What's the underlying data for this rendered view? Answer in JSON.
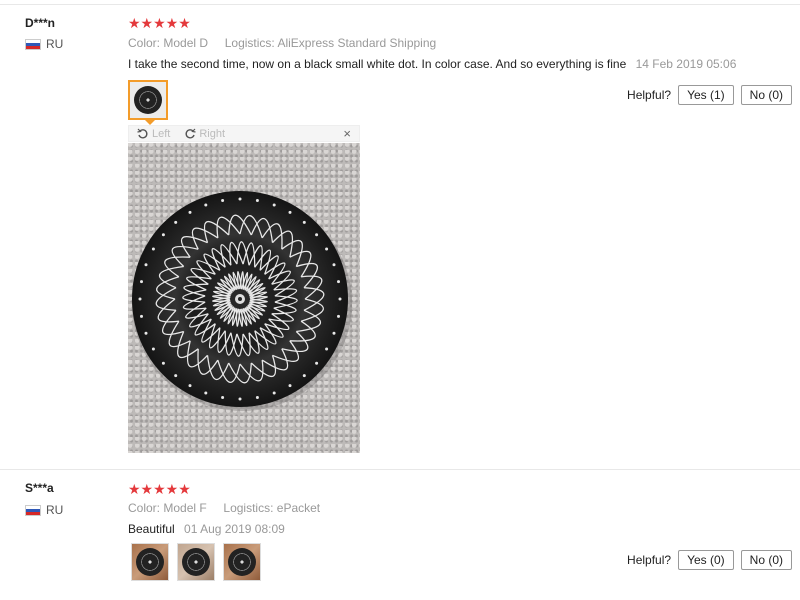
{
  "reviews": [
    {
      "user": "D***n",
      "country": "RU",
      "stars": "★★★★★",
      "color_label": "Color:",
      "color_value": "Model D",
      "logistics_label": "Logistics:",
      "logistics_value": "AliExpress Standard Shipping",
      "text": "I take the second time, now on a black small white dot. In color case. And so everything is fine",
      "date": "14 Feb 2019 05:06",
      "helpful_label": "Helpful?",
      "yes_label": "Yes (1)",
      "no_label": "No (0)"
    },
    {
      "user": "S***a",
      "country": "RU",
      "stars": "★★★★★",
      "color_label": "Color:",
      "color_value": "Model F",
      "logistics_label": "Logistics:",
      "logistics_value": "ePacket",
      "text": "Beautiful",
      "date": "01 Aug 2019 08:09",
      "helpful_label": "Helpful?",
      "yes_label": "Yes (0)",
      "no_label": "No (0)"
    }
  ],
  "viewer": {
    "rotate_left": "Left",
    "rotate_right": "Right",
    "close": "×"
  },
  "colors": {
    "star": "#e4393c",
    "active_thumb_border": "#f39c2a"
  },
  "icons": [
    "flag-ru-icon",
    "rotate-left-icon",
    "rotate-right-icon",
    "close-icon",
    "star-icon"
  ]
}
